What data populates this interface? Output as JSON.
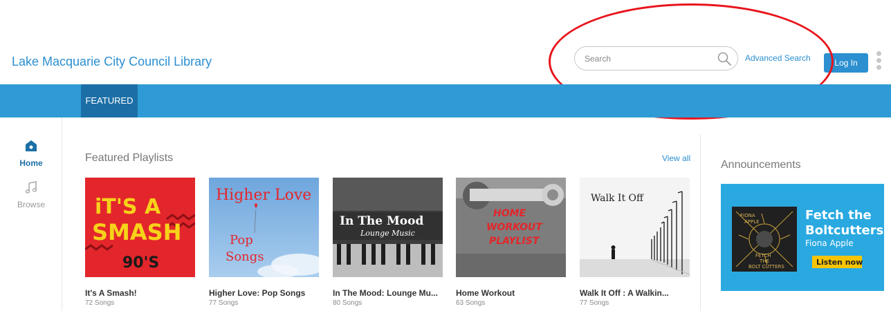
{
  "header": {
    "site_title": "Lake Macquarie City Council Library",
    "search_placeholder": "Search",
    "advanced_search": "Advanced Search",
    "login_label": "Log In"
  },
  "nav": {
    "tabs": [
      {
        "label": "FEATURED",
        "active": true
      }
    ]
  },
  "rail": {
    "home_label": "Home",
    "browse_label": "Browse"
  },
  "playlists": {
    "section_title": "Featured Playlists",
    "view_all": "View all",
    "items": [
      {
        "title": "It's A Smash!",
        "count": "72 Songs",
        "cover_text": [
          "iT'S A",
          "SMASH",
          "90'S"
        ]
      },
      {
        "title": "Higher Love: Pop Songs",
        "count": "77 Songs",
        "cover_text": [
          "Higher Love",
          "Pop",
          "Songs"
        ]
      },
      {
        "title": "In The Mood: Lounge Mu...",
        "count": "80 Songs",
        "cover_text": [
          "In The Mood",
          "Lounge Music"
        ]
      },
      {
        "title": "Home Workout",
        "count": "63 Songs",
        "cover_text": [
          "HOME",
          "WORKOUT",
          "PLAYLIST"
        ]
      },
      {
        "title": "Walk It Off : A Walkin...",
        "count": "77 Songs",
        "cover_text": [
          "Walk It Off"
        ]
      }
    ]
  },
  "announcements": {
    "title": "Announcements",
    "banner_heading_1": "Fetch the",
    "banner_heading_2": "Boltcutters",
    "banner_artist": "Fiona Apple",
    "banner_button": "Listen now",
    "album_art_text": [
      "FIONA",
      "APPLE",
      "FETCH",
      "THE",
      "BOLT CUTTERS"
    ]
  },
  "colors": {
    "brand_blue": "#2b8fd0",
    "nav_blue": "#2f9bd6",
    "nav_active": "#1c6fa6",
    "annotation_red": "#e8141c",
    "banner_cyan": "#2aa9e1",
    "banner_button": "#f6c400"
  }
}
